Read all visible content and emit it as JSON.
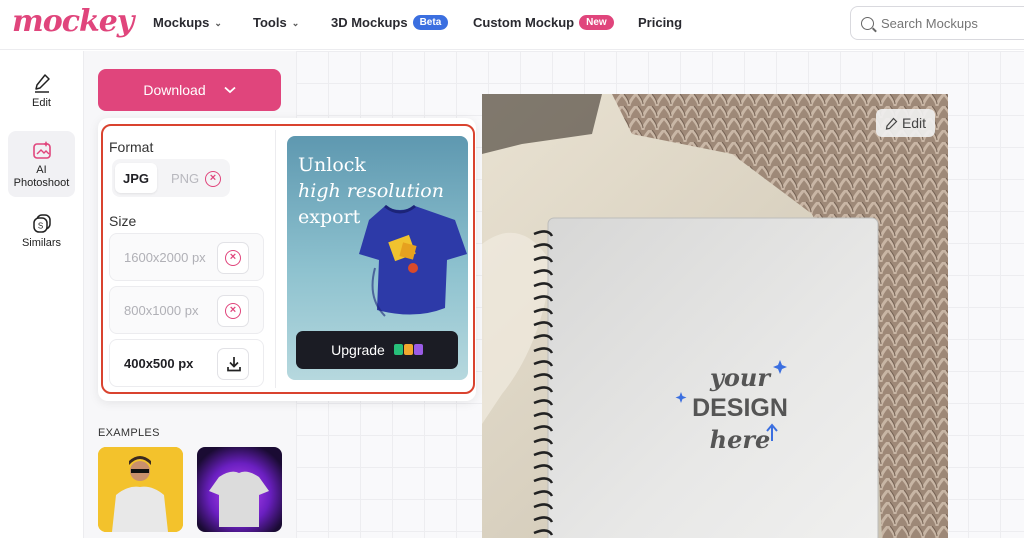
{
  "brand": {
    "logo_text": "mockey",
    "accent": "#e0457c"
  },
  "nav": {
    "items": [
      {
        "label": "Mockups",
        "has_chevron": true
      },
      {
        "label": "Tools",
        "has_chevron": true
      },
      {
        "label": "3D Mockups",
        "badge": "Beta"
      },
      {
        "label": "Custom Mockup",
        "badge": "New"
      },
      {
        "label": "Pricing"
      }
    ]
  },
  "search": {
    "placeholder": "Search Mockups"
  },
  "rail": {
    "items": [
      {
        "label": "Edit",
        "icon": "pencil-icon"
      },
      {
        "label": "AI\nPhotoshoot",
        "icon": "photoshoot-icon",
        "active": true
      },
      {
        "label": "Similars",
        "icon": "similars-icon"
      }
    ]
  },
  "download": {
    "button_label": "Download",
    "format_label": "Format",
    "formats": [
      "JPG",
      "PNG"
    ],
    "selected_format": "JPG",
    "size_label": "Size",
    "sizes": [
      {
        "label": "1600x2000 px",
        "available": false
      },
      {
        "label": "800x1000 px",
        "available": false
      },
      {
        "label": "400x500 px",
        "available": true
      }
    ]
  },
  "promo": {
    "line1": "Unlock",
    "line2": "high resolution",
    "line3": "export",
    "button_label": "Upgrade"
  },
  "examples": {
    "label": "EXAMPLES"
  },
  "canvas": {
    "edit_label": "Edit",
    "mockup_text": {
      "line1": "your",
      "line2": "DESIGN",
      "line3": "here"
    }
  }
}
